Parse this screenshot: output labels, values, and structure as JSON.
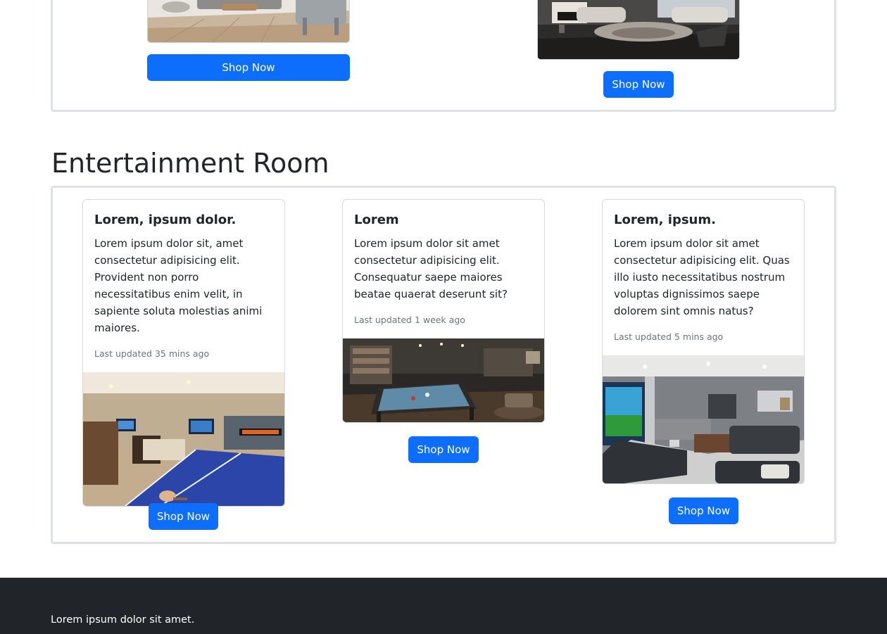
{
  "top_section": {
    "buttons": [
      "Shop Now",
      "Shop Now"
    ]
  },
  "entertainment": {
    "title": "Entertainment Room",
    "cards": [
      {
        "title": "Lorem, ipsum dolor.",
        "text": "Lorem ipsum dolor sit, amet consectetur adipisicing elit. Provident non porro necessitatibus enim velit, in sapiente soluta molestias animi maiores.",
        "updated": "Last updated 35 mins ago",
        "button": "Shop Now"
      },
      {
        "title": "Lorem",
        "text": "Lorem ipsum dolor sit amet consectetur adipisicing elit. Consequatur saepe maiores beatae quaerat deserunt sit?",
        "updated": "Last updated 1 week ago",
        "button": "Shop Now"
      },
      {
        "title": "Lorem, ipsum.",
        "text": "Lorem ipsum dolor sit amet consectetur adipisicing elit. Quas illo iusto necessitatibus nostrum voluptas dignissimos saepe dolorem sint omnis natus?",
        "updated": "Last updated 5 mins ago",
        "button": "Shop Now"
      }
    ]
  },
  "footer": {
    "text": "Lorem ipsum dolor sit amet."
  }
}
